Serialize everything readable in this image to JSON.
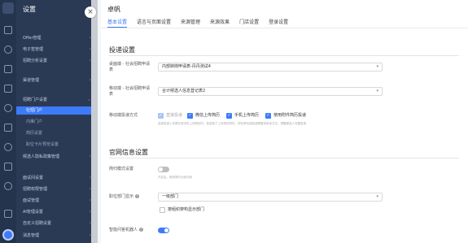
{
  "sidebar": {
    "title": "设置",
    "items": [
      {
        "label": "Offer管理",
        "kind": "item"
      },
      {
        "label": "电子签管理",
        "kind": "item"
      },
      {
        "label": "招聘分析设置",
        "kind": "item"
      },
      {
        "label": "渠道管理",
        "kind": "item"
      },
      {
        "label": "招聘门户设置",
        "kind": "item"
      },
      {
        "label": "社招门户",
        "kind": "sub"
      },
      {
        "label": "内推门户",
        "kind": "sub"
      },
      {
        "label": "简历设置",
        "kind": "sub"
      },
      {
        "label": "职位卡片预览设置",
        "kind": "sub"
      },
      {
        "label": "候选人隐私政策管理",
        "kind": "item"
      },
      {
        "label": "面试间设置",
        "kind": "item"
      },
      {
        "label": "招聘权限管理",
        "kind": "item"
      },
      {
        "label": "面试管理",
        "kind": "item"
      },
      {
        "label": "AI管理设置",
        "kind": "item"
      },
      {
        "label": "自定义招聘设置",
        "kind": "item"
      },
      {
        "label": "消息管理",
        "kind": "item"
      }
    ]
  },
  "main": {
    "title": "卓帆",
    "tabs": [
      "基本设置",
      "语言与页面设置",
      "来源管理",
      "来源效果",
      "门店设置",
      "登录设置"
    ],
    "delivery": {
      "title": "投递设置",
      "rows": [
        {
          "label": "桌面端 - 社会招聘申请表",
          "value": "内部转岗申请表-丹丹测试4"
        },
        {
          "label": "移动端 - 社会招聘申请表",
          "value": "合计候选人信息登记表2"
        }
      ],
      "method_label": "移动端投递方式",
      "methods": [
        {
          "label": "直接投递",
          "state": "disabled"
        },
        {
          "label": "微信上传简历",
          "state": "checked"
        },
        {
          "label": "手机上传简历",
          "state": "checked"
        },
        {
          "label": "使用附件简历投递",
          "state": "checked"
        }
      ],
      "hint": "选择投递上传简历或手机上传简历时，如选择了上传简历附件，则在移动端投递需要采用该方式，提醒候选人完善投递"
    },
    "site": {
      "title": "官网信息设置",
      "simple_label": "简归模式设置",
      "simple_hint": "开启后，使用简约大版归纳",
      "dept_label": "职位部门显示",
      "dept_value": "一级部门",
      "org_label": "按组织架构显示部门",
      "bot_label": "智能问答机器人"
    },
    "accent": "#3e7bfa"
  }
}
